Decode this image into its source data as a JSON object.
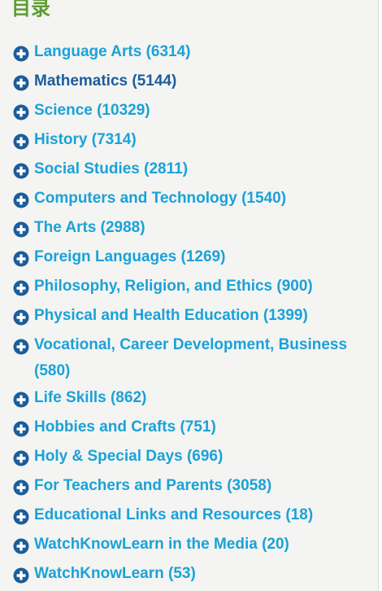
{
  "heading": "目录",
  "colors": {
    "link": "#1aa2d8",
    "link_active": "#1b5d9c",
    "heading": "#5d9c2f",
    "icon": "#1b5d9c"
  },
  "categories": [
    {
      "label": "Language Arts (6314)",
      "icon": "plus-circle-icon"
    },
    {
      "label": "Mathematics (5144)",
      "icon": "plus-circle-icon",
      "active": true
    },
    {
      "label": "Science (10329)",
      "icon": "plus-circle-icon"
    },
    {
      "label": "History (7314)",
      "icon": "plus-circle-icon"
    },
    {
      "label": "Social Studies (2811)",
      "icon": "plus-circle-icon"
    },
    {
      "label": "Computers and Technology (1540)",
      "icon": "plus-circle-icon"
    },
    {
      "label": "The Arts (2988)",
      "icon": "plus-circle-icon"
    },
    {
      "label": "Foreign Languages (1269)",
      "icon": "plus-circle-icon"
    },
    {
      "label": "Philosophy, Religion, and Ethics (900)",
      "icon": "plus-circle-icon"
    },
    {
      "label": "Physical and Health Education (1399)",
      "icon": "plus-circle-icon"
    },
    {
      "label": "Vocational, Career Development, Business (580)",
      "icon": "plus-circle-icon"
    },
    {
      "label": "Life Skills (862)",
      "icon": "plus-circle-icon"
    },
    {
      "label": "Hobbies and Crafts (751)",
      "icon": "plus-circle-icon"
    },
    {
      "label": "Holy & Special Days (696)",
      "icon": "plus-circle-icon"
    },
    {
      "label": "For Teachers and Parents (3058)",
      "icon": "plus-circle-icon"
    },
    {
      "label": "Educational Links and Resources (18)",
      "icon": "plus-circle-icon"
    },
    {
      "label": "WatchKnowLearn in the Media (20)",
      "icon": "plus-circle-icon"
    },
    {
      "label": "WatchKnowLearn (53)",
      "icon": "plus-circle-icon"
    }
  ]
}
